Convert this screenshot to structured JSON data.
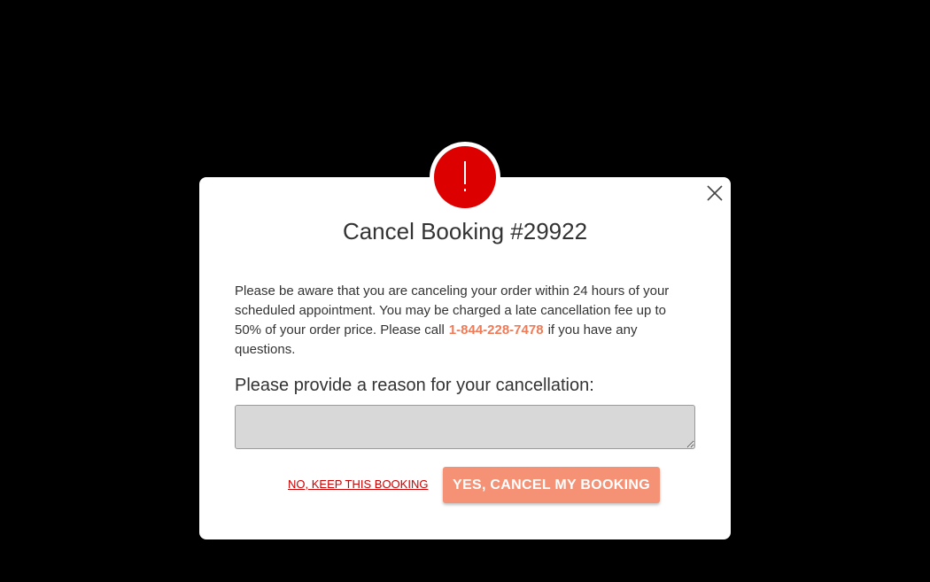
{
  "dialog": {
    "title": "Cancel Booking #29922",
    "alert_icon": "exclamation-icon",
    "close_icon": "close-icon",
    "notice_part1": "Please be aware that you are canceling your order within 24 hours of your scheduled appointment. You may be charged a late cancellation fee up to 50% of your order price. Please call",
    "phone": "1-844-228-7478",
    "notice_part2": "if you have any questions.",
    "reason_label": "Please provide a reason for your cancellation:",
    "reason_value": "",
    "keep_label": "NO, KEEP THIS BOOKING",
    "confirm_label": "YES, CANCEL MY BOOKING"
  },
  "colors": {
    "backdrop": "#000000",
    "alert": "#dd0000",
    "accent": "#f07a56",
    "confirm_button": "#f59275",
    "keep_link": "#cc0000"
  }
}
